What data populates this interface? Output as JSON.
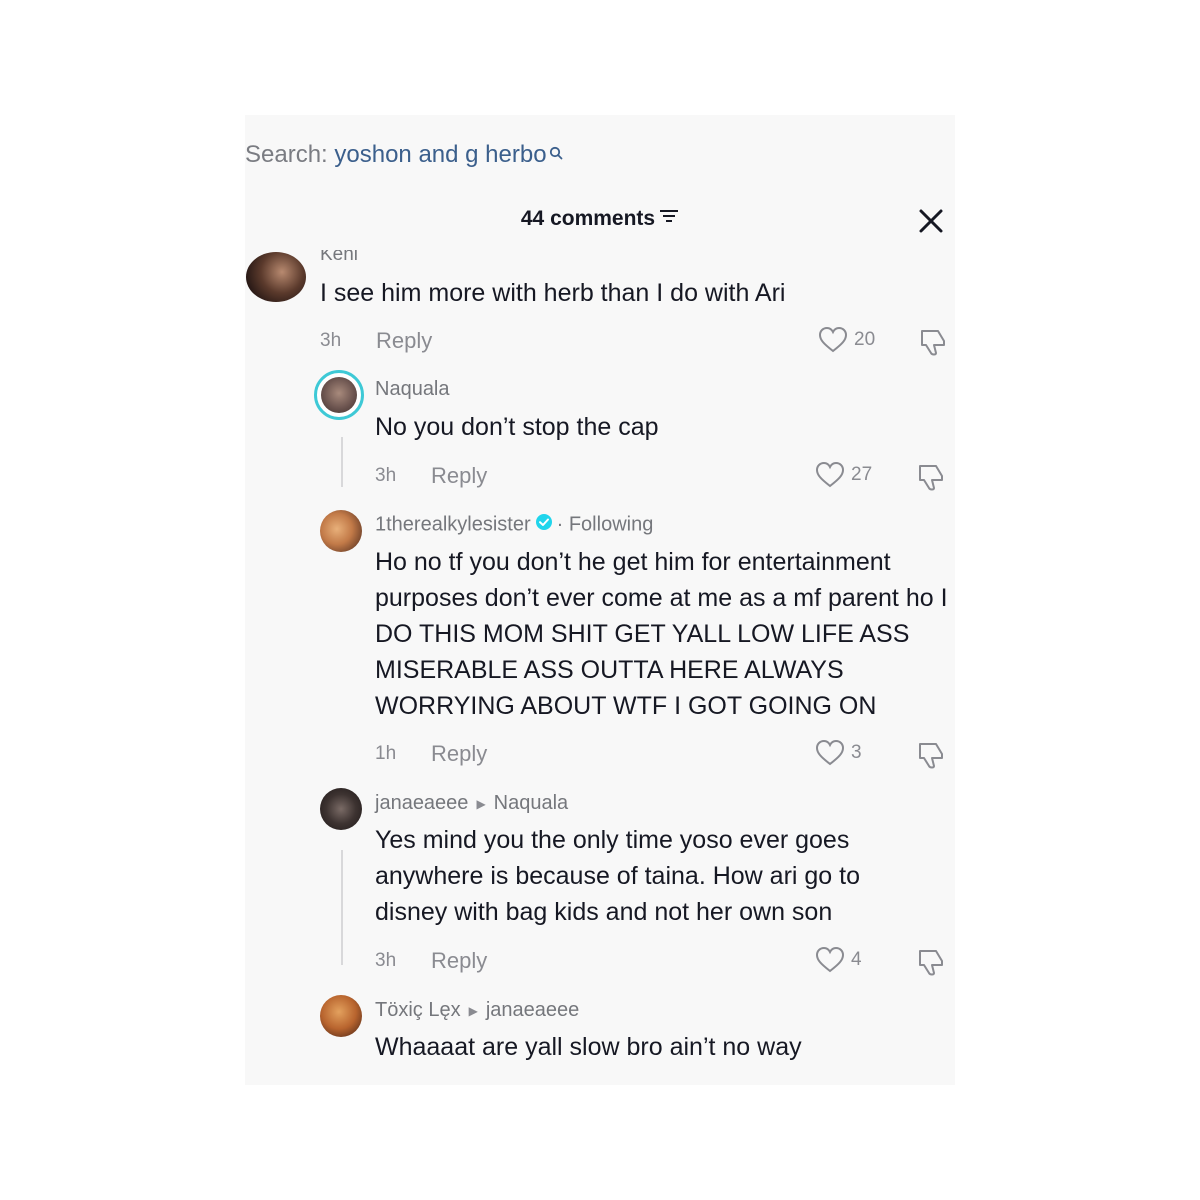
{
  "search": {
    "label": "Search:",
    "query": "yoshon and g herbo"
  },
  "header": {
    "title": "44 comments"
  },
  "comments": [
    {
      "username": "Keni",
      "text": "I see him more with herb than I do with Ari",
      "time": "3h",
      "reply": "Reply",
      "likes": "20"
    },
    {
      "username": "Naquala",
      "text": "No you don’t stop the cap",
      "time": "3h",
      "reply": "Reply",
      "likes": "27"
    },
    {
      "username": "1therealkylesister",
      "following": "· Following",
      "text": "Ho no tf you don’t he get him for entertainment purposes don’t ever come at me as a mf parent ho I DO THIS MOM SHIT GET YALL LOW LIFE ASS MISERABLE ASS OUTTA HERE ALWAYS WORRYING ABOUT WTF I GOT GOING ON",
      "time": "1h",
      "reply": "Reply",
      "likes": "3"
    },
    {
      "username": "janaeaeee",
      "reply_to": "Naquala",
      "text": "Yes mind you the only time yoso ever goes anywhere is because of taina. How ari go to disney with bag kids and not her own son",
      "time": "3h",
      "reply": "Reply",
      "likes": "4"
    },
    {
      "username": "Töxiç Lęx",
      "reply_to": "janaeaeee",
      "text": "Whaaaat are yall slow bro ain’t no way"
    }
  ],
  "colors": {
    "accent_link": "#3b5f8c",
    "verified": "#20d5ec",
    "story_ring": "#3ec9d6",
    "background": "#f8f8f8"
  }
}
